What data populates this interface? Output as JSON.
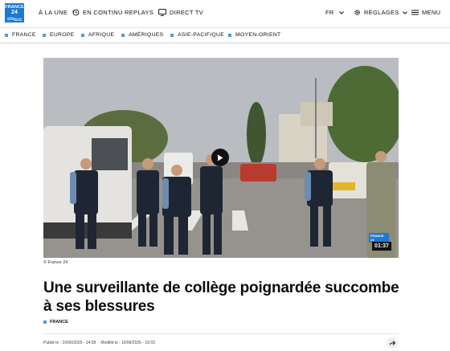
{
  "header": {
    "logo": {
      "line1": "FRANCE",
      "line2": "24",
      "color": "#1b7ad3"
    },
    "nav": [
      {
        "label": "À LA UNE",
        "icon": "home-icon"
      },
      {
        "label": "EN CONTINU",
        "icon": "history-clock-icon"
      },
      {
        "label": "REPLAYS",
        "icon": ""
      },
      {
        "label": "DIRECT TV",
        "icon": "tv-icon"
      }
    ],
    "language": "FR",
    "settings_label": "RÉGLAGES",
    "menu_label": "MENU"
  },
  "regions": [
    "FRANCE",
    "EUROPE",
    "AFRIQUE",
    "AMÉRIQUES",
    "ASIE-PACIFIQUE",
    "MOYEN-ORIENT"
  ],
  "accent_color": "#4a9be0",
  "video": {
    "badge": "FRANCE 24",
    "duration": "01:37",
    "credit": "© France 24"
  },
  "article": {
    "title": "Une surveillante de collège poignardée succombe à ses blessures",
    "tag": "FRANCE",
    "published": "Publié le : 10/06/2025 - 14:58",
    "modified": "Modifié le : 10/06/2025 - 15:03"
  }
}
